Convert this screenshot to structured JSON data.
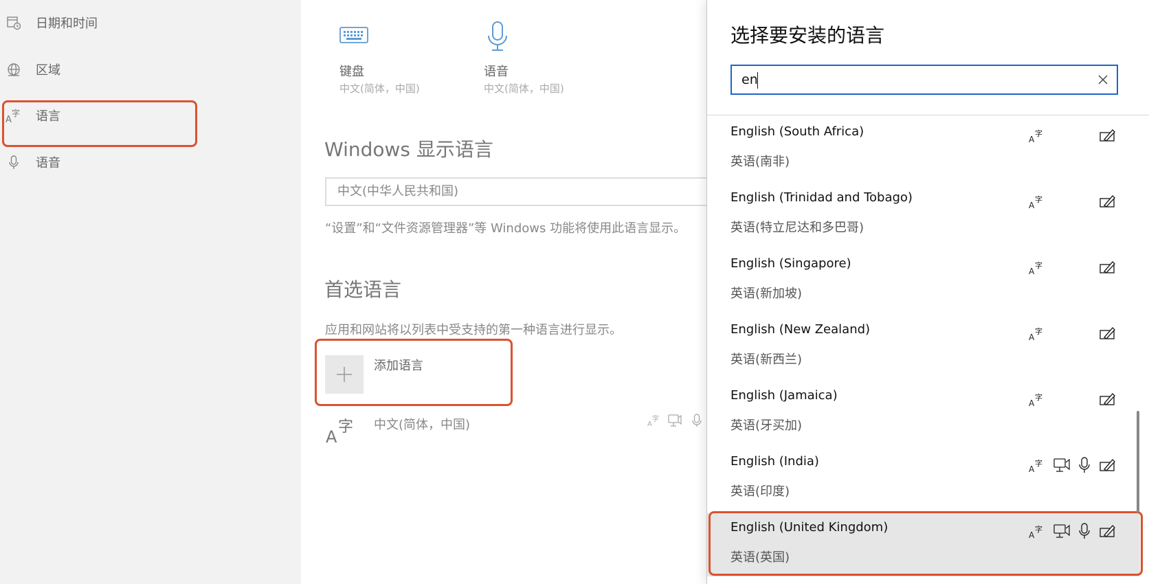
{
  "sidebar": {
    "items": [
      {
        "label": "日期和时间",
        "icon": "calendar-clock-icon"
      },
      {
        "label": "区域",
        "icon": "globe-icon"
      },
      {
        "label": "语言",
        "icon": "language-icon"
      },
      {
        "label": "语音",
        "icon": "microphone-icon"
      }
    ]
  },
  "main": {
    "keyboard": {
      "title": "键盘",
      "sub": "中文(简体，中国)",
      "icon": "keyboard-icon"
    },
    "speech": {
      "title": "语音",
      "sub": "中文(简体，中国)",
      "icon": "microphone-icon"
    },
    "display_heading": "Windows 显示语言",
    "display_value": "中文(中华人民共和国)",
    "display_desc": "“设置”和“文件资源管理器”等 Windows 功能将使用此语言显示。",
    "preferred_heading": "首选语言",
    "preferred_desc": "应用和网站将以列表中受支持的第一种语言进行显示。",
    "add_language": "添加语言",
    "installed": [
      {
        "name": "中文(简体，中国)"
      }
    ]
  },
  "flyout": {
    "title": "选择要安装的语言",
    "search": {
      "value": "en"
    },
    "languages": [
      {
        "en": "English (South Africa)",
        "zh": "英语(南非)",
        "features": [
          "language-pack-icon",
          "handwriting-icon"
        ],
        "selected": false
      },
      {
        "en": "English (Trinidad and Tobago)",
        "zh": "英语(特立尼达和多巴哥)",
        "features": [
          "language-pack-icon",
          "handwriting-icon"
        ],
        "selected": false
      },
      {
        "en": "English (Singapore)",
        "zh": "英语(新加坡)",
        "features": [
          "language-pack-icon",
          "handwriting-icon"
        ],
        "selected": false
      },
      {
        "en": "English (New Zealand)",
        "zh": "英语(新西兰)",
        "features": [
          "language-pack-icon",
          "handwriting-icon"
        ],
        "selected": false
      },
      {
        "en": "English (Jamaica)",
        "zh": "英语(牙买加)",
        "features": [
          "language-pack-icon",
          "handwriting-icon"
        ],
        "selected": false
      },
      {
        "en": "English (India)",
        "zh": "英语(印度)",
        "features": [
          "language-pack-icon",
          "text-to-speech-icon",
          "speech-recognition-icon",
          "handwriting-icon"
        ],
        "selected": false
      },
      {
        "en": "English (United Kingdom)",
        "zh": "英语(英国)",
        "features": [
          "language-pack-icon",
          "text-to-speech-icon",
          "speech-recognition-icon",
          "handwriting-icon"
        ],
        "selected": true
      }
    ]
  },
  "colors": {
    "highlight": "#d9532f",
    "accent": "#1e64c8",
    "selected_row": "#e6e6e6"
  }
}
